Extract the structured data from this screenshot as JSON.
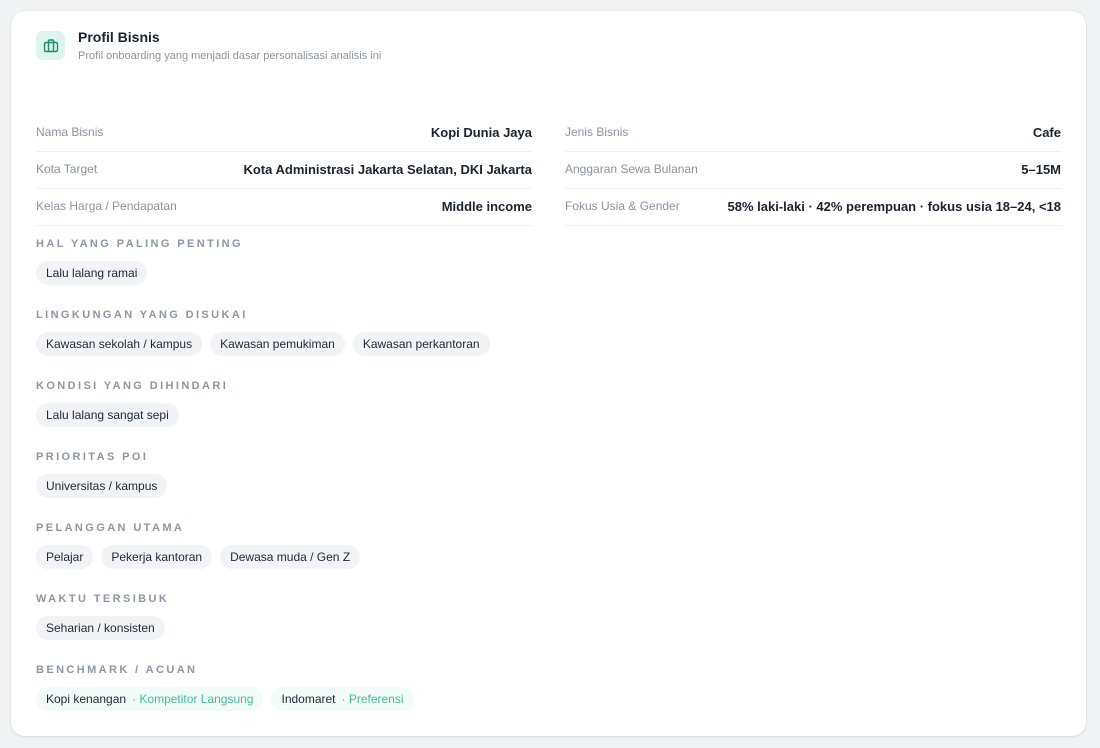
{
  "header": {
    "title": "Profil Bisnis",
    "subtitle": "Profil onboarding yang menjadi dasar personalisasi analisis ini",
    "icon": "briefcase-icon"
  },
  "left_rows": [
    {
      "label": "Nama Bisnis",
      "value": "Kopi Dunia Jaya"
    },
    {
      "label": "Kota Target",
      "value": "Kota Administrasi Jakarta Selatan, DKI Jakarta"
    },
    {
      "label": "Kelas Harga / Pendapatan",
      "value": "Middle income"
    }
  ],
  "right_rows": [
    {
      "label": "Jenis Bisnis",
      "value": "Cafe"
    },
    {
      "label": "Anggaran Sewa Bulanan",
      "value": "5–15M"
    },
    {
      "label": "Fokus Usia & Gender",
      "value": "58% laki-laki · 42% perempuan · fokus usia 18–24, <18"
    }
  ],
  "sections": [
    {
      "title": "Hal yang paling penting",
      "chips": [
        "Lalu lalang ramai"
      ]
    },
    {
      "title": "Lingkungan yang disukai",
      "chips": [
        "Kawasan sekolah / kampus",
        "Kawasan pemukiman",
        "Kawasan perkantoran"
      ]
    },
    {
      "title": "Kondisi yang dihindari",
      "chips": [
        "Lalu lalang sangat sepi"
      ]
    },
    {
      "title": "Prioritas POI",
      "chips": [
        "Universitas / kampus"
      ]
    },
    {
      "title": "Pelanggan utama",
      "chips": [
        "Pelajar",
        "Pekerja kantoran",
        "Dewasa muda / Gen Z"
      ]
    },
    {
      "title": "Waktu tersibuk",
      "chips": [
        "Seharian / konsisten"
      ]
    }
  ],
  "benchmark": {
    "title": "Benchmark / Acuan",
    "items": [
      {
        "name": "Kopi kenangan",
        "tag": "· Kompetitor Langsung"
      },
      {
        "name": "Indomaret",
        "tag": "· Preferensi"
      }
    ]
  },
  "colors": {
    "accent": "#3fbf98",
    "icon_bg": "#dcf5ee",
    "chip_bg": "#f1f3f6"
  }
}
